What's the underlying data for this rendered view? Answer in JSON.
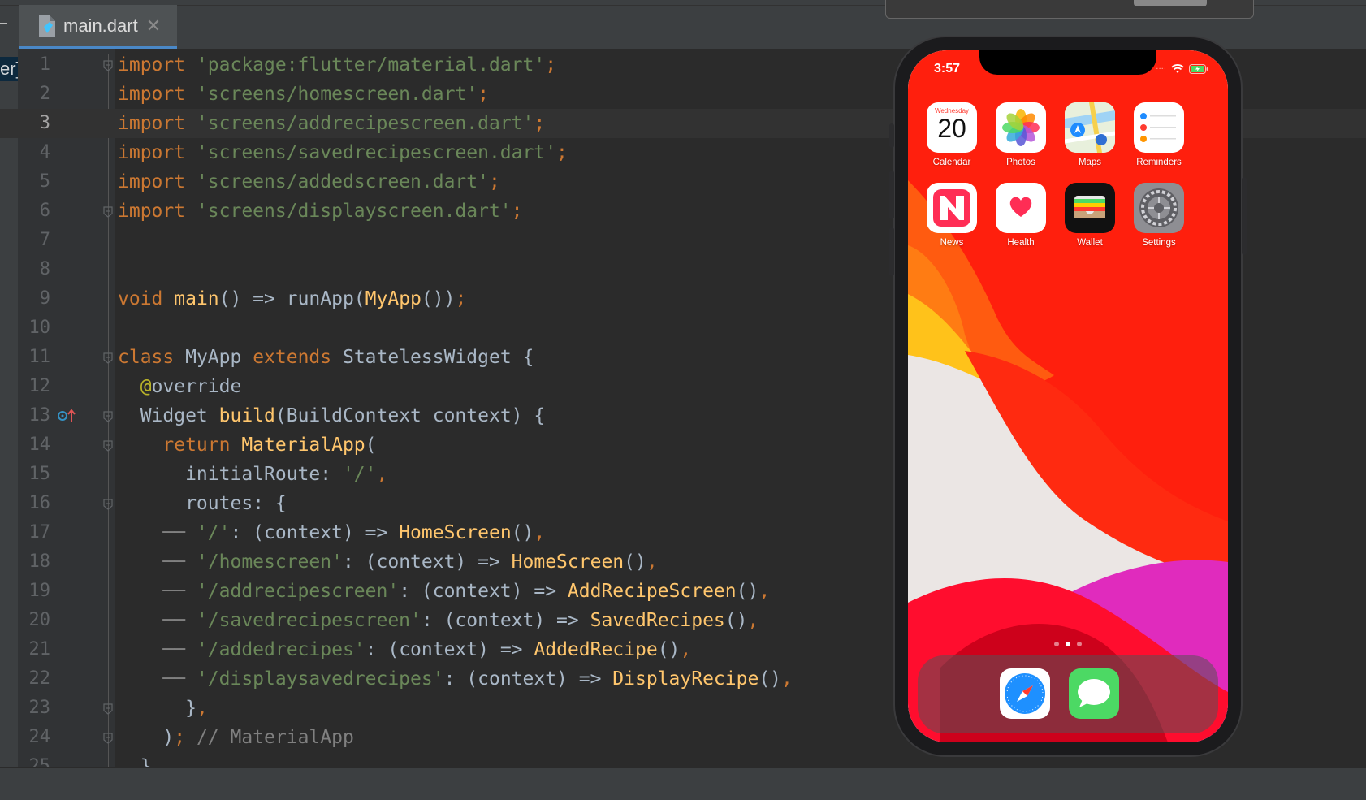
{
  "editor": {
    "tab_label": "main.dart",
    "left_panel_label": "er]",
    "current_line": 3,
    "lines": [
      {
        "n": "1",
        "tokens": [
          [
            "kw",
            "import "
          ],
          [
            "str",
            "'package:flutter/material.dart'"
          ],
          [
            "kw",
            ";"
          ]
        ]
      },
      {
        "n": "2",
        "tokens": [
          [
            "kw",
            "import "
          ],
          [
            "str",
            "'screens/homescreen.dart'"
          ],
          [
            "kw",
            ";"
          ]
        ]
      },
      {
        "n": "3",
        "tokens": [
          [
            "kw",
            "import "
          ],
          [
            "str",
            "'screens/addrecipescreen.dart'"
          ],
          [
            "kw",
            ";"
          ]
        ]
      },
      {
        "n": "4",
        "tokens": [
          [
            "kw",
            "import "
          ],
          [
            "str",
            "'screens/savedrecipescreen.dart'"
          ],
          [
            "kw",
            ";"
          ]
        ]
      },
      {
        "n": "5",
        "tokens": [
          [
            "kw",
            "import "
          ],
          [
            "str",
            "'screens/addedscreen.dart'"
          ],
          [
            "kw",
            ";"
          ]
        ]
      },
      {
        "n": "6",
        "tokens": [
          [
            "kw",
            "import "
          ],
          [
            "str",
            "'screens/displayscreen.dart'"
          ],
          [
            "kw",
            ";"
          ]
        ]
      },
      {
        "n": "7",
        "tokens": []
      },
      {
        "n": "8",
        "tokens": []
      },
      {
        "n": "9",
        "tokens": [
          [
            "kw",
            "void "
          ],
          [
            "fn",
            "main"
          ],
          [
            "t",
            "() => runApp("
          ],
          [
            "fn",
            "MyApp"
          ],
          [
            "t",
            "())"
          ],
          [
            "kw",
            ";"
          ]
        ]
      },
      {
        "n": "10",
        "tokens": []
      },
      {
        "n": "11",
        "tokens": [
          [
            "kw",
            "class "
          ],
          [
            "t",
            "MyApp "
          ],
          [
            "kw",
            "extends "
          ],
          [
            "t",
            "StatelessWidget {"
          ]
        ]
      },
      {
        "n": "12",
        "tokens": [
          [
            "t",
            "  "
          ],
          [
            "ann",
            "@"
          ],
          [
            "t",
            "override"
          ]
        ]
      },
      {
        "n": "13",
        "tokens": [
          [
            "t",
            "  Widget "
          ],
          [
            "fn",
            "build"
          ],
          [
            "t",
            "(BuildContext context) {"
          ]
        ]
      },
      {
        "n": "14",
        "tokens": [
          [
            "t",
            "    "
          ],
          [
            "kw",
            "return "
          ],
          [
            "fn",
            "MaterialApp"
          ],
          [
            "t",
            "("
          ]
        ]
      },
      {
        "n": "15",
        "tokens": [
          [
            "t",
            "      initialRoute: "
          ],
          [
            "str",
            "'/'"
          ],
          [
            "kw",
            ","
          ]
        ]
      },
      {
        "n": "16",
        "tokens": [
          [
            "t",
            "      routes: {"
          ]
        ]
      },
      {
        "n": "17",
        "tokens": [
          [
            "cm",
            "    ── "
          ],
          [
            "str",
            "'/'"
          ],
          [
            "t",
            ": (context) => "
          ],
          [
            "fn",
            "HomeScreen"
          ],
          [
            "t",
            "()"
          ],
          [
            "kw",
            ","
          ]
        ]
      },
      {
        "n": "18",
        "tokens": [
          [
            "cm",
            "    ── "
          ],
          [
            "str",
            "'/homescreen'"
          ],
          [
            "t",
            ": (context) => "
          ],
          [
            "fn",
            "HomeScreen"
          ],
          [
            "t",
            "()"
          ],
          [
            "kw",
            ","
          ]
        ]
      },
      {
        "n": "19",
        "tokens": [
          [
            "cm",
            "    ── "
          ],
          [
            "str",
            "'/addrecipescreen'"
          ],
          [
            "t",
            ": (context) => "
          ],
          [
            "fn",
            "AddRecipeScreen"
          ],
          [
            "t",
            "()"
          ],
          [
            "kw",
            ","
          ]
        ]
      },
      {
        "n": "20",
        "tokens": [
          [
            "cm",
            "    ── "
          ],
          [
            "str",
            "'/savedrecipescreen'"
          ],
          [
            "t",
            ": (context) => "
          ],
          [
            "fn",
            "SavedRecipes"
          ],
          [
            "t",
            "()"
          ],
          [
            "kw",
            ","
          ]
        ]
      },
      {
        "n": "21",
        "tokens": [
          [
            "cm",
            "    ── "
          ],
          [
            "str",
            "'/addedrecipes'"
          ],
          [
            "t",
            ": (context) => "
          ],
          [
            "fn",
            "AddedRecipe"
          ],
          [
            "t",
            "()"
          ],
          [
            "kw",
            ","
          ]
        ]
      },
      {
        "n": "22",
        "tokens": [
          [
            "cm",
            "    ── "
          ],
          [
            "str",
            "'/displaysavedrecipes'"
          ],
          [
            "t",
            ": (context) => "
          ],
          [
            "fn",
            "DisplayRecipe"
          ],
          [
            "t",
            "()"
          ],
          [
            "kw",
            ","
          ]
        ]
      },
      {
        "n": "23",
        "tokens": [
          [
            "t",
            "      }"
          ],
          [
            "kw",
            ","
          ]
        ]
      },
      {
        "n": "24",
        "tokens": [
          [
            "t",
            "    )"
          ],
          [
            "kw",
            "; "
          ],
          [
            "cm",
            "// MaterialApp"
          ]
        ]
      },
      {
        "n": "25",
        "tokens": [
          [
            "t",
            "  }"
          ]
        ]
      }
    ]
  },
  "phone": {
    "time": "3:57",
    "calendar_weekday": "Wednesday",
    "calendar_day": "20",
    "apps": [
      {
        "label": "Calendar",
        "icon": "calendar-icon"
      },
      {
        "label": "Photos",
        "icon": "photos-icon"
      },
      {
        "label": "Maps",
        "icon": "maps-icon"
      },
      {
        "label": "Reminders",
        "icon": "reminders-icon"
      },
      {
        "label": "News",
        "icon": "news-icon"
      },
      {
        "label": "Health",
        "icon": "health-icon"
      },
      {
        "label": "Wallet",
        "icon": "wallet-icon"
      },
      {
        "label": "Settings",
        "icon": "settings-icon"
      }
    ],
    "dock": [
      {
        "icon": "safari-icon"
      },
      {
        "icon": "messages-icon"
      }
    ],
    "page_count": 3,
    "current_page": 2
  },
  "colors": {
    "keyword": "#cc7832",
    "string": "#6a8759",
    "function": "#ffc66d",
    "annotation": "#bbb529",
    "comment": "#808080",
    "text": "#a9b7c6",
    "wallpaper_red": "#ff1a0a"
  }
}
